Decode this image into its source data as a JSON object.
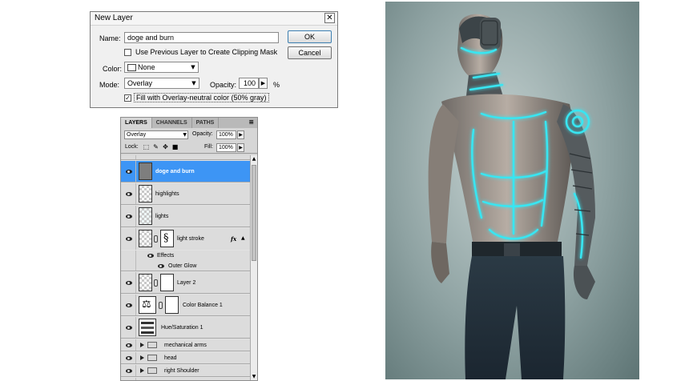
{
  "dialog": {
    "title": "New Layer",
    "close_glyph": "✕",
    "name_label": "Name:",
    "name_value": "doge and burn",
    "use_previous_label": "Use Previous Layer to Create Clipping Mask",
    "use_previous_checked": false,
    "color_label": "Color:",
    "color_value": "None",
    "mode_label": "Mode:",
    "mode_value": "Overlay",
    "opacity_label": "Opacity:",
    "opacity_value": "100",
    "opacity_unit": "%",
    "fill_label": "Fill with Overlay-neutral color (50% gray)",
    "fill_checked": true,
    "check_glyph": "✓",
    "ok_label": "OK",
    "cancel_label": "Cancel"
  },
  "layers_panel": {
    "tabs": [
      "LAYERS",
      "CHANNELS",
      "PATHS"
    ],
    "menu_glyph": "≡",
    "blend_mode": "Overlay",
    "opacity_label": "Opacity:",
    "opacity_value": "100%",
    "lock_label": "Lock:",
    "fill_label": "Fill:",
    "fill_value": "100%",
    "effects_label": "Effects",
    "outer_glow_label": "Outer Glow",
    "fx_label": "fx",
    "layers": [
      {
        "name": "doge and burn",
        "selected": true
      },
      {
        "name": "highlights"
      },
      {
        "name": "lights"
      },
      {
        "name": "light stroke"
      },
      {
        "name": "Layer 2"
      },
      {
        "name": "Color Balance 1"
      },
      {
        "name": "Hue/Saturation 1"
      },
      {
        "name": "mechanical arms"
      },
      {
        "name": "head"
      },
      {
        "name": "right Shoulder"
      }
    ]
  },
  "colors": {
    "selection": "#3d95f5",
    "glow": "#39e6f2"
  }
}
